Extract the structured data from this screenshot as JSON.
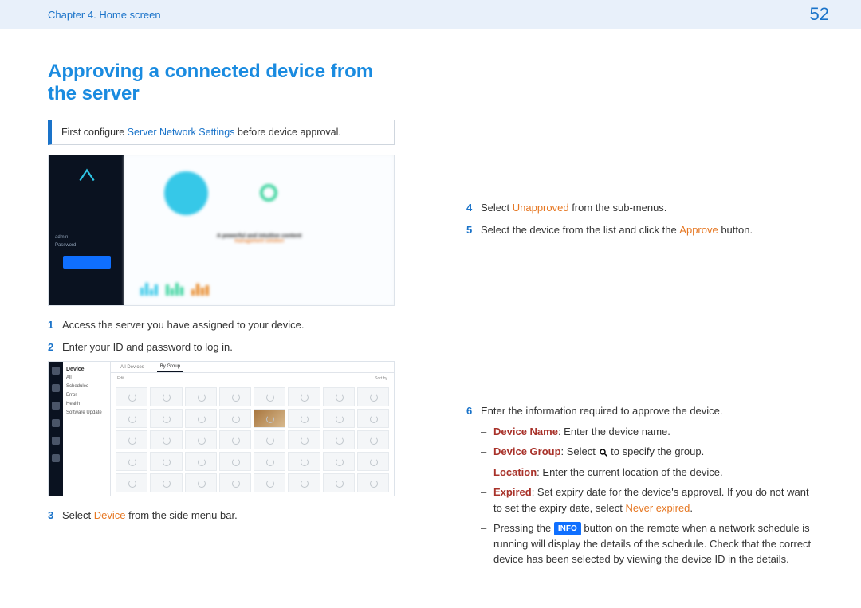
{
  "header": {
    "chapter": "Chapter 4. Home screen",
    "page_number": "52"
  },
  "heading": "Approving a connected device from the server",
  "note": {
    "prefix": "First configure ",
    "link": "Server Network Settings",
    "suffix": " before device approval."
  },
  "screenshot1": {
    "tagline1": "A powerful and intuitive content",
    "tagline2": "management solution"
  },
  "screenshot2": {
    "panel_title": "Device",
    "tabs": [
      "All Devices",
      "By Group"
    ],
    "toolbar_left": "Edit",
    "toolbar_right": "Sort by"
  },
  "steps_left": [
    {
      "n": "1",
      "text": "Access the server you have assigned to your device."
    },
    {
      "n": "2",
      "text": "Enter your ID and password to log in."
    },
    {
      "n": "3",
      "pre": "Select ",
      "hl": "Device",
      "post": " from the side menu bar."
    }
  ],
  "steps_right": {
    "s4": {
      "pre": "Select ",
      "hl": "Unapproved",
      "post": " from the sub-menus."
    },
    "s5": {
      "pre": "Select the device from the list and click the ",
      "hl": "Approve",
      "post": " button."
    },
    "s6": {
      "text": "Enter the information required to approve the device.",
      "bullets": [
        {
          "term": "Device Name",
          "desc": ": Enter the device name."
        },
        {
          "term": "Device Group",
          "desc_pre": ": Select ",
          "desc_post": " to specify the group."
        },
        {
          "term": "Location",
          "desc": ": Enter the current location of the device."
        },
        {
          "term": "Expired",
          "desc_pre": ": Set expiry date for the device's approval. If you do not want to set the expiry date, select ",
          "hl": "Never expired",
          "desc_post": "."
        },
        {
          "plain_pre": "Pressing the ",
          "badge": "INFO",
          "plain_post": " button on the remote when a network schedule is running will display the details of the schedule. Check that the correct device has been selected by viewing the device ID in the details."
        }
      ]
    }
  }
}
